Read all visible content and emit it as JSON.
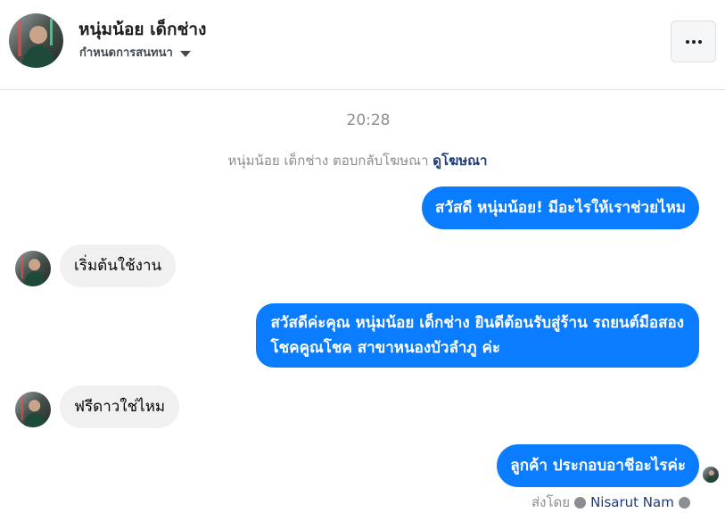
{
  "header": {
    "name": "หนุ่มน้อย เด็กช่าง",
    "subtitle": "กำหนดการสนทนา",
    "more_icon": "more-horizontal-icon"
  },
  "conversation": {
    "timestamp": "20:28",
    "system_message": {
      "text": "หนุ่มน้อย เด็กช่าง ตอบกลับโฆษณา",
      "link": "ดูโฆษณา"
    },
    "messages": [
      {
        "direction": "outgoing",
        "lines": [
          "สวัสดี หนุ่มน้อย! มีอะไรให้เราช่วยไหม"
        ]
      },
      {
        "direction": "incoming",
        "lines": [
          "เริ่มต้นใช้งาน"
        ]
      },
      {
        "direction": "outgoing",
        "lines": [
          "สวัสดีค่ะคุณ หนุ่มน้อย เด็กช่าง ยินดีต้อนรับสู่ร้าน รถยนต์มือสอง",
          "โชคคูณโชค สาขาหนองบัวลำภู ค่ะ"
        ]
      },
      {
        "direction": "incoming",
        "lines": [
          "ฟรีดาวใช่ไหม"
        ]
      },
      {
        "direction": "outgoing",
        "lines": [
          "ลูกค้า ประกอบอาชีอะไรค่ะ"
        ]
      }
    ],
    "sent_by": {
      "label": "ส่งโดย",
      "name": "Nisarut Nam"
    }
  },
  "colors": {
    "outgoing_bubble": "#0a7cff",
    "incoming_bubble": "#f0f0f0",
    "link": "#1d3c78",
    "muted": "#8a8d91"
  }
}
